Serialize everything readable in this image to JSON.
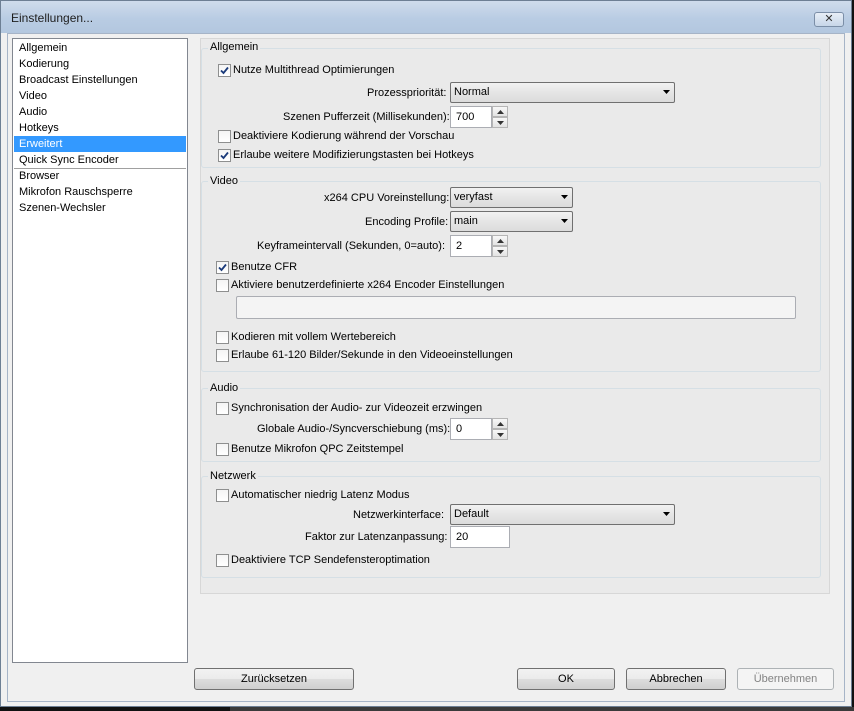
{
  "window": {
    "title": "Einstellungen...",
    "close_glyph": "✕"
  },
  "sidebar": {
    "items": [
      {
        "label": "Allgemein"
      },
      {
        "label": "Kodierung"
      },
      {
        "label": "Broadcast Einstellungen"
      },
      {
        "label": "Video"
      },
      {
        "label": "Audio"
      },
      {
        "label": "Hotkeys"
      },
      {
        "label": "Erweitert",
        "selected": true
      },
      {
        "label": "Quick Sync Encoder"
      },
      {
        "label": "Browser"
      },
      {
        "label": "Mikrofon Rauschsperre"
      },
      {
        "label": "Szenen-Wechsler"
      }
    ]
  },
  "allgemein": {
    "title": "Allgemein",
    "multithread": {
      "label": "Nutze Multithread Optimierungen",
      "checked": true
    },
    "priority": {
      "label": "Prozesspriorität:",
      "value": "Normal"
    },
    "buffer": {
      "label": "Szenen Pufferzeit (Millisekunden):",
      "value": "700"
    },
    "disable_preview": {
      "label": "Deaktiviere Kodierung während der Vorschau",
      "checked": false
    },
    "modifier_keys": {
      "label": "Erlaube weitere Modifizierungstasten bei Hotkeys",
      "checked": true
    }
  },
  "video": {
    "title": "Video",
    "preset": {
      "label": "x264 CPU Voreinstellung:",
      "value": "veryfast"
    },
    "profile": {
      "label": "Encoding Profile:",
      "value": "main"
    },
    "keyframe": {
      "label": "Keyframeintervall (Sekunden, 0=auto):",
      "value": "2"
    },
    "cfr": {
      "label": "Benutze CFR",
      "checked": true
    },
    "custom_x264": {
      "label": "Aktiviere benutzerdefinierte x264 Encoder Einstellungen",
      "checked": false,
      "value": ""
    },
    "full_range": {
      "label": "Kodieren mit vollem Wertebereich",
      "checked": false
    },
    "high_fps": {
      "label": "Erlaube 61-120 Bilder/Sekunde in den Videoeinstellungen",
      "checked": false
    }
  },
  "audio": {
    "title": "Audio",
    "sync": {
      "label": "Synchronisation der Audio- zur Videozeit erzwingen",
      "checked": false
    },
    "offset": {
      "label": "Globale Audio-/Syncverschiebung (ms):",
      "value": "0"
    },
    "qpc": {
      "label": "Benutze Mikrofon QPC Zeitstempel",
      "checked": false
    }
  },
  "netzwerk": {
    "title": "Netzwerk",
    "low_latency": {
      "label": "Automatischer niedrig Latenz Modus",
      "checked": false
    },
    "interface": {
      "label": "Netzwerkinterface:",
      "value": "Default"
    },
    "latency_factor": {
      "label": "Faktor zur Latenzanpassung:",
      "value": "20"
    },
    "tcp": {
      "label": "Deaktiviere TCP Sendefensteroptimation",
      "checked": false
    }
  },
  "buttons": {
    "reset": "Zurücksetzen",
    "ok": "OK",
    "cancel": "Abbrechen",
    "apply": "Übernehmen"
  }
}
